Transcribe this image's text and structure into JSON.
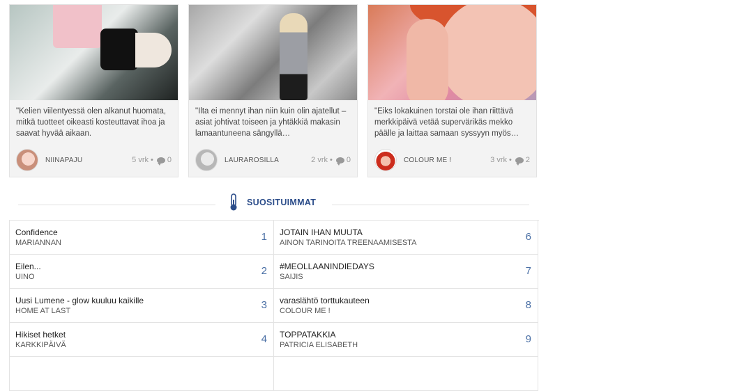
{
  "cards": [
    {
      "excerpt": "\"Kelien viilentyessä olen alkanut huomata, mitkä tuotteet oikeasti kosteuttavat ihoa ja saavat hyvää aikaan.",
      "author": "NIINAPAJU",
      "age": "5 vrk",
      "sep": "•",
      "comments": "0"
    },
    {
      "excerpt": "\"Ilta ei mennyt ihan niin kuin olin ajatellut – asiat johtivat toiseen ja yhtäkkiä makasin lamaantuneena sängyllä…",
      "author": "LAURAROSILLA",
      "age": "2 vrk",
      "sep": "•",
      "comments": "0"
    },
    {
      "excerpt": "\"Eiks lokakuinen torstai ole ihan riittävä merkkipäivä vetää supervärikäs mekko päälle ja laittaa samaan syssyyn myös…",
      "author": "COLOUR ME !",
      "age": "3 vrk",
      "sep": "•",
      "comments": "2"
    }
  ],
  "section": {
    "title": "SUOSITUIMMAT",
    "icon": "thermometer-icon",
    "accent": "#2c4d8a"
  },
  "popular": [
    {
      "rank": "1",
      "title": "Confidence",
      "blog": "MARIANNAN"
    },
    {
      "rank": "6",
      "title": "JOTAIN IHAN MUUTA",
      "blog": "AINON TARINOITA TREENAAMISESTA"
    },
    {
      "rank": "2",
      "title": "Eilen...",
      "blog": "UINO"
    },
    {
      "rank": "7",
      "title": "#MEOLLAANINDIEDAYS",
      "blog": "SAIJIS"
    },
    {
      "rank": "3",
      "title": "Uusi Lumene - glow kuuluu kaikille",
      "blog": "HOME AT LAST"
    },
    {
      "rank": "8",
      "title": "varaslähtö torttukauteen",
      "blog": "COLOUR ME !"
    },
    {
      "rank": "4",
      "title": "Hikiset hetket",
      "blog": "KARKKIPÄIVÄ"
    },
    {
      "rank": "9",
      "title": "TOPPATAKKIA",
      "blog": "PATRICIA ELISABETH"
    }
  ]
}
